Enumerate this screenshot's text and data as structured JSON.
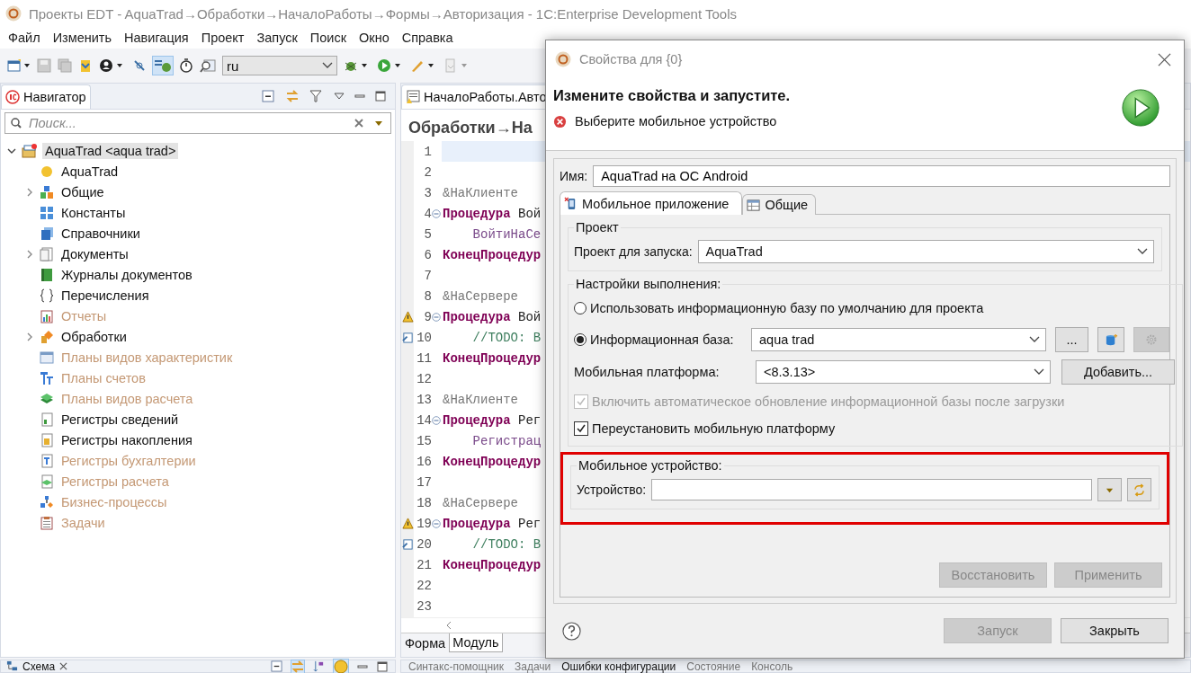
{
  "window": {
    "title": "Проекты EDT - AquaTrad→Обработки→НачалоРаботы→Формы→Авторизация - 1C:Enterprise Development Tools"
  },
  "menu": [
    "Файл",
    "Изменить",
    "Навигация",
    "Проект",
    "Запуск",
    "Поиск",
    "Окно",
    "Справка"
  ],
  "toolbar": {
    "language": "ru"
  },
  "navigator": {
    "tab": "Навигатор",
    "search": {
      "placeholder": "Поиск..."
    },
    "tree": [
      {
        "label": "AquaTrad <aqua trad>",
        "expanded": true,
        "selected": true,
        "children": [
          {
            "label": "AquaTrad",
            "expandable": false,
            "dimmed": false
          },
          {
            "label": "Общие",
            "expandable": true,
            "dimmed": false
          },
          {
            "label": "Константы",
            "expandable": false,
            "dimmed": false
          },
          {
            "label": "Справочники",
            "expandable": false,
            "dimmed": false
          },
          {
            "label": "Документы",
            "expandable": true,
            "dimmed": false
          },
          {
            "label": "Журналы документов",
            "expandable": false,
            "dimmed": false
          },
          {
            "label": "Перечисления",
            "expandable": false,
            "dimmed": false
          },
          {
            "label": "Отчеты",
            "expandable": false,
            "dimmed": true
          },
          {
            "label": "Обработки",
            "expandable": true,
            "dimmed": false
          },
          {
            "label": "Планы видов характеристик",
            "expandable": false,
            "dimmed": true
          },
          {
            "label": "Планы счетов",
            "expandable": false,
            "dimmed": true
          },
          {
            "label": "Планы видов расчета",
            "expandable": false,
            "dimmed": true
          },
          {
            "label": "Регистры сведений",
            "expandable": false,
            "dimmed": false
          },
          {
            "label": "Регистры накопления",
            "expandable": false,
            "dimmed": false
          },
          {
            "label": "Регистры бухгалтерии",
            "expandable": false,
            "dimmed": true
          },
          {
            "label": "Регистры расчета",
            "expandable": false,
            "dimmed": true
          },
          {
            "label": "Бизнес-процессы",
            "expandable": false,
            "dimmed": true
          },
          {
            "label": "Задачи",
            "expandable": false,
            "dimmed": true
          }
        ]
      }
    ]
  },
  "editor": {
    "tab": "НачалоРаботы.Авто",
    "heading": "Обработки→На",
    "lines": [
      {
        "number": "1",
        "kind": "code",
        "current": true,
        "fold": false
      },
      {
        "number": "2",
        "kind": "code",
        "current": false,
        "fold": false
      },
      {
        "number": "3",
        "kind": "code",
        "current": false,
        "fold": false,
        "segments": [
          {
            "text": "&НаКлиенте",
            "kind": "directive"
          }
        ]
      },
      {
        "number": "4",
        "kind": "code",
        "current": false,
        "fold": true,
        "segments": [
          {
            "text": "Процедура",
            "kind": "keyword"
          },
          {
            "text": " Вой",
            "kind": "plain"
          }
        ]
      },
      {
        "number": "5",
        "kind": "code",
        "current": false,
        "fold": false,
        "segments": [
          {
            "text": "    ВойтиНаСе",
            "kind": "call"
          }
        ]
      },
      {
        "number": "6",
        "kind": "code",
        "current": false,
        "fold": false,
        "segments": [
          {
            "text": "КонецПроцедур",
            "kind": "keyword"
          }
        ]
      },
      {
        "number": "7",
        "kind": "code",
        "current": false,
        "fold": false
      },
      {
        "number": "8",
        "kind": "code",
        "current": false,
        "fold": false,
        "segments": [
          {
            "text": "&НаСервере",
            "kind": "directive"
          }
        ]
      },
      {
        "number": "9",
        "kind": "warning",
        "current": false,
        "fold": true,
        "segments": [
          {
            "text": "Процедура",
            "kind": "keyword"
          },
          {
            "text": " Вой",
            "kind": "plain"
          }
        ]
      },
      {
        "number": "10",
        "kind": "task",
        "current": false,
        "fold": false,
        "segments": [
          {
            "text": "    //TODO: В",
            "kind": "comment"
          }
        ]
      },
      {
        "number": "11",
        "kind": "code",
        "current": false,
        "fold": false,
        "segments": [
          {
            "text": "КонецПроцедур",
            "kind": "keyword"
          }
        ]
      },
      {
        "number": "12",
        "kind": "code",
        "current": false,
        "fold": false
      },
      {
        "number": "13",
        "kind": "code",
        "current": false,
        "fold": false,
        "segments": [
          {
            "text": "&НаКлиенте",
            "kind": "directive"
          }
        ]
      },
      {
        "number": "14",
        "kind": "code",
        "current": false,
        "fold": true,
        "segments": [
          {
            "text": "Процедура",
            "kind": "keyword"
          },
          {
            "text": " Рег",
            "kind": "plain"
          }
        ]
      },
      {
        "number": "15",
        "kind": "code",
        "current": false,
        "fold": false,
        "segments": [
          {
            "text": "    Регистрац",
            "kind": "call"
          }
        ]
      },
      {
        "number": "16",
        "kind": "code",
        "current": false,
        "fold": false,
        "segments": [
          {
            "text": "КонецПроцедур",
            "kind": "keyword"
          }
        ]
      },
      {
        "number": "17",
        "kind": "code",
        "current": false,
        "fold": false
      },
      {
        "number": "18",
        "kind": "code",
        "current": false,
        "fold": false,
        "segments": [
          {
            "text": "&НаСервере",
            "kind": "directive"
          }
        ]
      },
      {
        "number": "19",
        "kind": "warning",
        "current": false,
        "fold": true,
        "segments": [
          {
            "text": "Процедура",
            "kind": "keyword"
          },
          {
            "text": " Рег",
            "kind": "plain"
          }
        ]
      },
      {
        "number": "20",
        "kind": "task",
        "current": false,
        "fold": false,
        "segments": [
          {
            "text": "    //TODO: В",
            "kind": "comment"
          }
        ]
      },
      {
        "number": "21",
        "kind": "code",
        "current": false,
        "fold": false,
        "segments": [
          {
            "text": "КонецПроцедур",
            "kind": "keyword"
          }
        ]
      },
      {
        "number": "22",
        "kind": "code",
        "current": false,
        "fold": false
      },
      {
        "number": "23",
        "kind": "code",
        "current": false,
        "fold": false
      }
    ],
    "bottom_tabs": [
      {
        "label": "Форма",
        "selected": false
      },
      {
        "label": "Модуль",
        "selected": true
      }
    ]
  },
  "outline": {
    "tab": "Схема"
  },
  "bottom_panel": {
    "tabs": [
      {
        "label": "Синтакс-помощник",
        "selected": false
      },
      {
        "label": "Задачи",
        "selected": false
      },
      {
        "label": "Ошибки конфигурации",
        "selected": true
      },
      {
        "label": "Состояние",
        "selected": false
      },
      {
        "label": "Консоль",
        "selected": false
      }
    ]
  },
  "dialog": {
    "title": "Свойства для {0}",
    "heading": "Измените свойства и запустите.",
    "message": {
      "kind": "error",
      "text": "Выберите мобильное устройство"
    },
    "name": {
      "label": "Имя:",
      "value": "AquaTrad на ОС Android"
    },
    "tabs": [
      {
        "label": "Мобильное приложение",
        "selected": true
      },
      {
        "label": "Общие",
        "selected": false
      }
    ],
    "project_group": {
      "title": "Проект",
      "label": "Проект для запуска:",
      "value": "AquaTrad"
    },
    "run_group": {
      "title": "Настройки выполнения:",
      "radios": [
        {
          "label": "Использовать информационную базу по умолчанию для проекта",
          "selected": false
        },
        {
          "label": "Информационная база:",
          "selected": true
        }
      ],
      "infobase": {
        "value": "aqua trad",
        "browse_button": "..."
      },
      "platform": {
        "label": "Мобильная платформа:",
        "value": "<8.3.13>",
        "add_button": "Добавить..."
      },
      "checkboxes": [
        {
          "label": "Включить автоматическое обновление информационной базы после загрузки",
          "checked": true,
          "disabled": true
        },
        {
          "label": "Переустановить мобильную платформу",
          "checked": true,
          "disabled": false
        }
      ]
    },
    "device_group": {
      "title": "Мобильное устройство:",
      "label": "Устройство:",
      "highlighted": true
    },
    "actions": [
      {
        "label": "Восстановить",
        "disabled": true
      },
      {
        "label": "Применить",
        "disabled": true
      }
    ],
    "footer": [
      {
        "label": "Запуск",
        "disabled": true
      },
      {
        "label": "Закрыть",
        "disabled": false
      }
    ]
  }
}
